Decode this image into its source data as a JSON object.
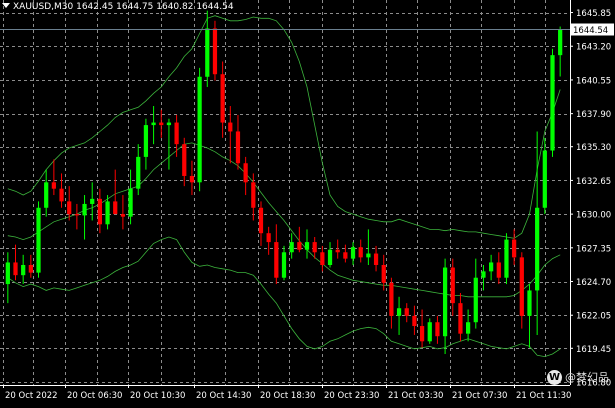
{
  "header": {
    "symbol_timeframe": "XAUUSD,M30",
    "ohlc": "1642.45 1644.75 1640.82 1644.54"
  },
  "watermark": {
    "text": "@梦幻品"
  },
  "colors": {
    "background": "#000000",
    "grid": "#8c8c8c",
    "bull": "#00ff00",
    "bear": "#ff0000",
    "bands": "#3cb43c",
    "axis_text": "#ffffff",
    "price_line": "#6a7f8f"
  },
  "chart_data": {
    "type": "candlestick",
    "title": "",
    "symbol": "XAUUSD",
    "timeframe": "M30",
    "current_price": 1644.54,
    "current_price_label": "1644.54",
    "ylim": [
      1616.8,
      1646.6
    ],
    "y_ticks": [
      "1645.85",
      "1643.20",
      "1640.55",
      "1637.90",
      "1635.30",
      "1632.65",
      "1630.00",
      "1627.35",
      "1624.70",
      "1622.05",
      "1619.45",
      "1616.80"
    ],
    "x_ticks": [
      "20 Oct 2022",
      "20 Oct 06:30",
      "20 Oct 10:30",
      "20 Oct 14:30",
      "20 Oct 18:30",
      "20 Oct 23:30",
      "21 Oct 03:30",
      "21 Oct 07:30",
      "21 Oct 11:30"
    ],
    "grid": true,
    "indicator": "Bollinger Bands",
    "candles": [
      [
        1624.5,
        1627.0,
        1623.0,
        1626.2
      ],
      [
        1626.2,
        1627.6,
        1624.8,
        1625.2
      ],
      [
        1625.2,
        1626.8,
        1624.5,
        1626.0
      ],
      [
        1626.0,
        1626.8,
        1625.0,
        1625.4
      ],
      [
        1625.4,
        1631.0,
        1625.0,
        1630.5
      ],
      [
        1630.5,
        1633.5,
        1629.8,
        1632.5
      ],
      [
        1632.5,
        1634.3,
        1631.5,
        1632.0
      ],
      [
        1632.0,
        1633.2,
        1630.5,
        1631.0
      ],
      [
        1631.0,
        1632.2,
        1629.5,
        1630.0
      ],
      [
        1630.0,
        1630.8,
        1628.8,
        1629.9
      ],
      [
        1629.9,
        1631.5,
        1628.0,
        1630.8
      ],
      [
        1630.8,
        1632.5,
        1629.5,
        1631.2
      ],
      [
        1631.2,
        1632.0,
        1628.5,
        1629.2
      ],
      [
        1629.2,
        1631.5,
        1628.8,
        1631.0
      ],
      [
        1631.0,
        1633.5,
        1630.5,
        1630.0
      ],
      [
        1630.0,
        1631.5,
        1628.8,
        1629.8
      ],
      [
        1629.8,
        1633.5,
        1629.2,
        1632.0
      ],
      [
        1632.0,
        1635.5,
        1631.5,
        1634.5
      ],
      [
        1634.5,
        1637.5,
        1633.5,
        1637.0
      ],
      [
        1637.0,
        1638.5,
        1635.5,
        1637.2
      ],
      [
        1637.2,
        1638.2,
        1636.0,
        1637.0
      ],
      [
        1637.0,
        1637.5,
        1633.5,
        1637.2
      ],
      [
        1637.2,
        1637.8,
        1634.5,
        1635.5
      ],
      [
        1635.5,
        1636.0,
        1632.2,
        1633.0
      ],
      [
        1633.0,
        1634.2,
        1631.5,
        1632.5
      ],
      [
        1632.5,
        1641.5,
        1631.8,
        1640.8
      ],
      [
        1640.8,
        1646.0,
        1640.0,
        1644.6
      ],
      [
        1644.6,
        1645.2,
        1640.5,
        1641.0
      ],
      [
        1641.0,
        1642.0,
        1636.0,
        1637.2
      ],
      [
        1637.2,
        1638.5,
        1634.0,
        1636.5
      ],
      [
        1636.5,
        1637.8,
        1633.5,
        1634.0
      ],
      [
        1634.0,
        1634.5,
        1631.5,
        1632.5
      ],
      [
        1632.5,
        1633.2,
        1629.5,
        1630.5
      ],
      [
        1630.5,
        1631.0,
        1627.5,
        1628.5
      ],
      [
        1628.5,
        1629.0,
        1626.8,
        1627.8
      ],
      [
        1627.8,
        1629.2,
        1624.5,
        1625.0
      ],
      [
        1625.0,
        1627.5,
        1624.8,
        1627.0
      ],
      [
        1627.0,
        1628.5,
        1626.5,
        1627.8
      ],
      [
        1627.8,
        1629.0,
        1627.0,
        1627.2
      ],
      [
        1627.2,
        1628.8,
        1626.5,
        1627.8
      ],
      [
        1627.8,
        1628.2,
        1626.5,
        1627.0
      ],
      [
        1627.0,
        1627.5,
        1625.5,
        1626.0
      ],
      [
        1626.0,
        1627.8,
        1625.8,
        1627.2
      ],
      [
        1627.2,
        1628.0,
        1626.5,
        1627.0
      ],
      [
        1627.0,
        1627.6,
        1626.2,
        1626.5
      ],
      [
        1626.5,
        1627.8,
        1626.0,
        1627.4
      ],
      [
        1627.4,
        1628.0,
        1626.2,
        1626.6
      ],
      [
        1626.6,
        1628.8,
        1626.0,
        1626.9
      ],
      [
        1626.9,
        1627.5,
        1625.5,
        1626.0
      ],
      [
        1626.0,
        1626.8,
        1624.0,
        1624.6
      ],
      [
        1624.6,
        1625.0,
        1621.0,
        1622.0
      ],
      [
        1622.0,
        1623.5,
        1620.5,
        1622.6
      ],
      [
        1622.6,
        1623.0,
        1621.5,
        1622.0
      ],
      [
        1622.0,
        1622.8,
        1620.5,
        1621.2
      ],
      [
        1621.2,
        1622.5,
        1619.5,
        1620.0
      ],
      [
        1620.0,
        1621.8,
        1619.8,
        1621.5
      ],
      [
        1621.5,
        1622.0,
        1619.8,
        1620.4
      ],
      [
        1620.4,
        1626.5,
        1619.0,
        1625.8
      ],
      [
        1625.8,
        1626.5,
        1622.0,
        1623.0
      ],
      [
        1623.0,
        1623.8,
        1620.0,
        1620.6
      ],
      [
        1620.6,
        1622.5,
        1620.0,
        1621.5
      ],
      [
        1621.5,
        1626.5,
        1621.0,
        1625.0
      ],
      [
        1625.0,
        1626.0,
        1624.0,
        1625.5
      ],
      [
        1625.5,
        1626.8,
        1624.8,
        1626.2
      ],
      [
        1626.2,
        1627.0,
        1624.5,
        1625.0
      ],
      [
        1625.0,
        1628.5,
        1624.5,
        1628.0
      ],
      [
        1628.0,
        1628.8,
        1626.0,
        1626.6
      ],
      [
        1626.6,
        1627.0,
        1621.0,
        1622.0
      ],
      [
        1622.0,
        1624.5,
        1619.5,
        1624.0
      ],
      [
        1624.0,
        1636.5,
        1620.5,
        1630.5
      ],
      [
        1630.5,
        1636.0,
        1630.0,
        1635.0
      ],
      [
        1635.0,
        1643.0,
        1634.5,
        1642.5
      ],
      [
        1642.5,
        1644.75,
        1640.82,
        1644.54
      ]
    ],
    "bb_upper": [
      1632,
      1631.8,
      1631.5,
      1631.8,
      1632.6,
      1633.5,
      1634.2,
      1634.8,
      1635.2,
      1635.4,
      1635.6,
      1636.0,
      1636.5,
      1637.0,
      1637.6,
      1638.0,
      1638.2,
      1638.4,
      1638.9,
      1639.5,
      1640.0,
      1640.8,
      1641.5,
      1642.4,
      1643.0,
      1644.2,
      1645.4,
      1645.6,
      1645.4,
      1645.2,
      1645.2,
      1645.3,
      1645.5,
      1645.4,
      1645.4,
      1645.2,
      1644.5,
      1643.5,
      1642.0,
      1640.0,
      1637.0,
      1634.0,
      1631.5,
      1630.6,
      1630.2,
      1630.0,
      1629.8,
      1629.6,
      1629.5,
      1629.4,
      1629.4,
      1629.6,
      1629.4,
      1629.2,
      1629.0,
      1628.8,
      1628.8,
      1628.7,
      1628.8,
      1628.7,
      1628.6,
      1628.6,
      1628.5,
      1628.4,
      1628.3,
      1628.2,
      1628.1,
      1628.5,
      1630.0,
      1633.5,
      1636.5,
      1638.0,
      1639.8
    ],
    "bb_middle": [
      1628.3,
      1628.2,
      1628.0,
      1628.2,
      1628.6,
      1629.0,
      1629.4,
      1629.6,
      1629.8,
      1630.0,
      1630.3,
      1630.5,
      1630.8,
      1631.2,
      1631.6,
      1631.8,
      1632.0,
      1632.2,
      1632.8,
      1633.5,
      1634.0,
      1634.5,
      1635.0,
      1635.5,
      1635.6,
      1635.4,
      1635.2,
      1634.9,
      1634.5,
      1634.2,
      1633.8,
      1633.2,
      1632.5,
      1631.7,
      1630.9,
      1630.2,
      1629.5,
      1628.7,
      1627.9,
      1627.2,
      1626.6,
      1626.1,
      1625.6,
      1625.2,
      1625.0,
      1624.8,
      1624.7,
      1624.6,
      1624.5,
      1624.4,
      1624.4,
      1624.3,
      1624.2,
      1624.1,
      1624.0,
      1623.9,
      1623.8,
      1623.7,
      1623.6,
      1623.6,
      1623.5,
      1623.5,
      1623.5,
      1623.5,
      1623.5,
      1623.5,
      1623.6,
      1624.0,
      1624.5,
      1625.2,
      1626.0,
      1626.5,
      1626.8
    ],
    "bb_lower": [
      1625.0,
      1624.6,
      1624.3,
      1624.5,
      1624.3,
      1624.0,
      1624.2,
      1624.1,
      1624.0,
      1624.2,
      1624.4,
      1624.6,
      1624.8,
      1625.1,
      1625.5,
      1625.8,
      1626.0,
      1626.3,
      1627.0,
      1627.7,
      1628.0,
      1628.2,
      1628.0,
      1627.0,
      1626.2,
      1625.9,
      1626.0,
      1625.8,
      1625.7,
      1625.6,
      1625.4,
      1625.4,
      1625.2,
      1624.5,
      1623.7,
      1623.0,
      1622.0,
      1621.0,
      1620.2,
      1619.6,
      1619.4,
      1619.6,
      1620.0,
      1620.2,
      1620.5,
      1620.8,
      1621.0,
      1621.1,
      1621.0,
      1620.6,
      1620.0,
      1619.8,
      1619.6,
      1619.4,
      1619.5,
      1619.6,
      1619.4,
      1619.5,
      1619.8,
      1620.0,
      1620.2,
      1620.0,
      1619.8,
      1619.6,
      1619.5,
      1619.4,
      1619.6,
      1619.8,
      1619.6,
      1618.9,
      1618.8,
      1619.0,
      1619.4
    ]
  }
}
